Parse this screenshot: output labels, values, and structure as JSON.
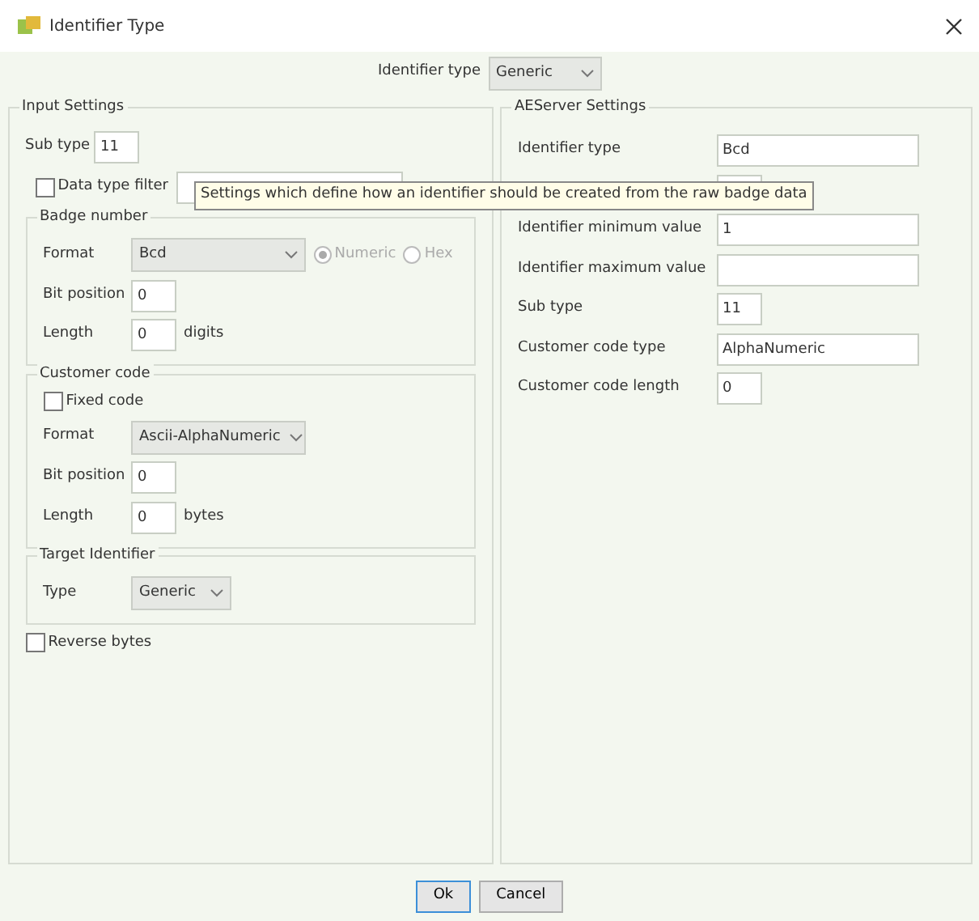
{
  "window": {
    "title": "Identifier Type"
  },
  "identifier_type": {
    "label": "Identifier type",
    "value": "Generic"
  },
  "input_settings": {
    "title": "Input Settings",
    "sub_type": {
      "label": "Sub type",
      "value": "11"
    },
    "data_type_filter": {
      "label": "Data type filter",
      "checked": false
    },
    "badge_number": {
      "title": "Badge number",
      "format": {
        "label": "Format",
        "value": "Bcd"
      },
      "radios": [
        {
          "label": "Numeric",
          "selected": true
        },
        {
          "label": "Hex",
          "selected": false
        }
      ],
      "bit_position": {
        "label": "Bit position",
        "value": "0"
      },
      "length": {
        "label": "Length",
        "value": "0",
        "unit": "digits"
      }
    },
    "customer_code": {
      "title": "Customer code",
      "fixed_code": {
        "label": "Fixed code",
        "checked": false
      },
      "format": {
        "label": "Format",
        "value": "Ascii-AlphaNumeric"
      },
      "bit_position": {
        "label": "Bit position",
        "value": "0"
      },
      "length": {
        "label": "Length",
        "value": "0",
        "unit": "bytes"
      }
    },
    "target_identifier": {
      "title": "Target Identifier",
      "type": {
        "label": "Type",
        "value": "Generic"
      }
    },
    "reverse_bytes": {
      "label": "Reverse bytes",
      "checked": false
    }
  },
  "aeserver_settings": {
    "title": "AEServer Settings",
    "rows": [
      {
        "label": "Identifier type",
        "value": "Bcd",
        "kind": "wide"
      },
      {
        "kind": "short"
      },
      {
        "label": "Identifier minimum value",
        "value": "1",
        "kind": "wide"
      },
      {
        "label": "Identifier maximum value",
        "kind": "wide"
      },
      {
        "label": "Sub type",
        "value": "11",
        "kind": "short"
      },
      {
        "label": "Customer code type",
        "value": "AlphaNumeric",
        "kind": "wide"
      },
      {
        "label": "Customer code length",
        "value": "0",
        "kind": "short"
      }
    ]
  },
  "tooltip": "Settings which define how an identifier should be created from the raw badge data",
  "buttons": [
    {
      "label": "Ok",
      "default": true
    },
    {
      "label": "Cancel",
      "default": false
    }
  ]
}
